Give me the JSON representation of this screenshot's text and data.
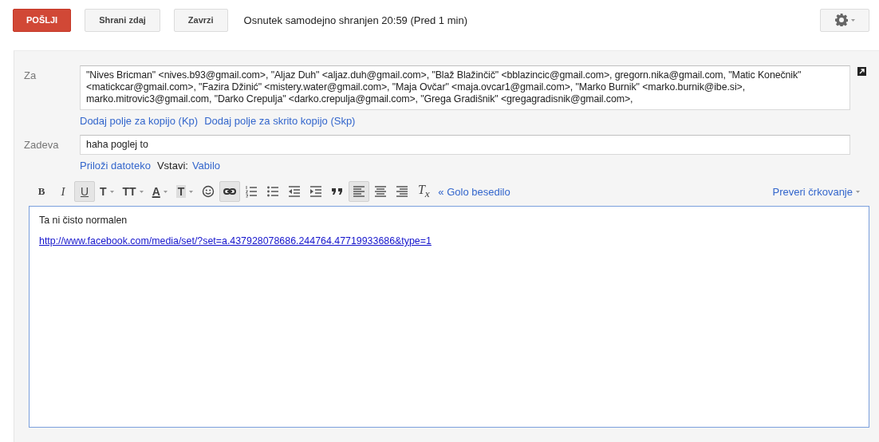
{
  "top_bar": {
    "send_button": "POŠLJI",
    "buttons": [
      "Shrani zdaj",
      "Zavrzi"
    ],
    "status": "Osnutek samodejno shranjen 20:59 (Pred 1 min)"
  },
  "to": {
    "label": "Za",
    "value": "\"Nives Bricman\" <nives.b93@gmail.com>, \"Aljaz Duh\" <aljaz.duh@gmail.com>, \"Blaž Blažinčič\" <bblazincic@gmail.com>, gregorn.nika@gmail.com, \"Matic Konečnik\" <matickcar@gmail.com>, \"Fazira Džinić\" <mistery.water@gmail.com>, \"Maja Ovčar\" <maja.ovcar1@gmail.com>, \"Marko Burnik\" <marko.burnik@ibe.si>, marko.mitrovic3@gmail.com, \"Darko Crepulja\" <darko.crepulja@gmail.com>, \"Grega Gradišnik\" <gregagradisnik@gmail.com>,"
  },
  "recipient_links": [
    "Dodaj polje za kopijo (Kp)",
    "Dodaj polje za skrito kopijo (Skp)"
  ],
  "subject": {
    "label": "Zadeva",
    "value": "haha poglej to"
  },
  "attach_link": "Priloži datoteko",
  "insert": {
    "label": "Vstavi:",
    "link": "Vabilo"
  },
  "toolbar": [
    {
      "kind": "bold",
      "label": "B",
      "selected": false
    },
    {
      "kind": "italic",
      "label": "I",
      "selected": false
    },
    {
      "kind": "underline",
      "label": "U",
      "selected": true
    },
    {
      "kind": "font",
      "label": "T",
      "selected": false
    },
    {
      "kind": "size",
      "label": "TT",
      "selected": false
    },
    {
      "kind": "color",
      "label": "A",
      "selected": false
    },
    {
      "kind": "highlight",
      "label": "T",
      "selected": false
    },
    {
      "kind": "emoji",
      "selected": false
    },
    {
      "kind": "link",
      "selected": true
    },
    {
      "kind": "numbered-list",
      "selected": false
    },
    {
      "kind": "bulleted-list",
      "selected": false
    },
    {
      "kind": "outdent",
      "selected": false
    },
    {
      "kind": "indent",
      "selected": false
    },
    {
      "kind": "quote",
      "selected": false
    },
    {
      "kind": "align-left",
      "selected": true
    },
    {
      "kind": "align-center",
      "selected": false
    },
    {
      "kind": "align-right",
      "selected": false
    },
    {
      "kind": "clear-format",
      "label": "T$_{x}$",
      "selected": false
    }
  ],
  "plain_text_link": "« Golo besedilo",
  "spellcheck_link": "Preveri črkovanje",
  "body": [
    {
      "kind": "text",
      "text": "Ta ni čisto normalen"
    },
    {
      "kind": "link",
      "text": "http://www.facebook.com/media/set/?set=a.437928078686.244764.47719933686&type=1"
    }
  ]
}
